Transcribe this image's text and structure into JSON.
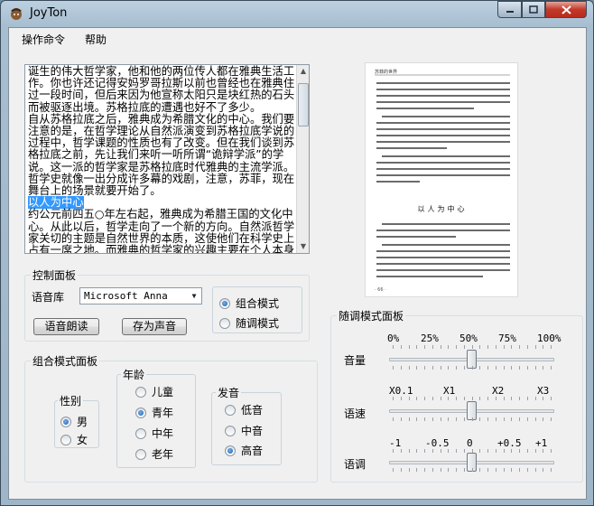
{
  "window": {
    "title": "JoyTon"
  },
  "menu": {
    "items": [
      {
        "label": "操作命令"
      },
      {
        "label": "帮助"
      }
    ]
  },
  "editor": {
    "text_normal_1": "诞生的伟大哲学家，他和他的两位传人都在雅典生活工作。你也许还记得安妈罗哥拉斯以前也曾经也在雅典住过一段时间，但后来因为他宣称太阳只是块红热的石头而被驱逐出境。苏格拉底的遭遇也好不了多少。",
    "text_normal_2": "自从苏格拉底之后，雅典成为希腊文化的中心。我们要注意的是，在哲学理论从自然派演变到苏格拉底学说的过程中，哲学课题的性质也有了改变。但在我们谈到苏格拉底之前，先让我们来听一听所谓“诡辩学派”的学说。这一派的哲学家是苏格拉底时代雅典的主流学派。哲学史就像一出分成许多幕的戏剧，注意，苏菲，现在舞台上的场景就要开始了。",
    "text_selected": "以人为中心",
    "text_normal_3": "约公元前四五○年左右起，雅典成为希腊王国的文化中心。从此以后，哲学走向了一个新的方向。自然派哲学家关切的主题是自然世界的本质，这使他们在科学史上占有一席之地。而雅典的哲学家的兴趣主要在个人本身与每个人在社会的地位。当时雅典正逐渐形成一个拥"
  },
  "scanned_page": {
    "header": "苏菲的世界",
    "heading": "以人为中心",
    "footer": "· 66 ·"
  },
  "control_panel": {
    "title": "控制面板",
    "voice_label": "语音库",
    "voice_selected": "Microsoft Anna",
    "read_button": "语音朗读",
    "save_button": "存为声音",
    "mode_combo": "组合模式",
    "mode_tune": "随调模式",
    "mode_selected": "combo"
  },
  "combo_panel": {
    "title": "组合模式面板",
    "gender": {
      "label": "性别",
      "options": [
        "男",
        "女"
      ],
      "selected": "男"
    },
    "age": {
      "label": "年龄",
      "options": [
        "儿童",
        "青年",
        "中年",
        "老年"
      ],
      "selected": "青年"
    },
    "pitch": {
      "label": "发音",
      "options": [
        "低音",
        "中音",
        "高音"
      ],
      "selected": "高音"
    }
  },
  "tune_panel": {
    "title": "随调模式面板",
    "volume": {
      "label": "音量",
      "ticks": [
        "0%",
        "25%",
        "50%",
        "75%",
        "100%"
      ],
      "value_fraction": 0.5
    },
    "speed": {
      "label": "语速",
      "ticks": [
        "X0.1",
        "X1",
        "X2",
        "X3"
      ],
      "value_fraction": 0.5
    },
    "tone": {
      "label": "语调",
      "ticks": [
        "-1",
        "-0.5",
        "0",
        "+0.5",
        "+1"
      ],
      "value_fraction": 0.5
    }
  }
}
